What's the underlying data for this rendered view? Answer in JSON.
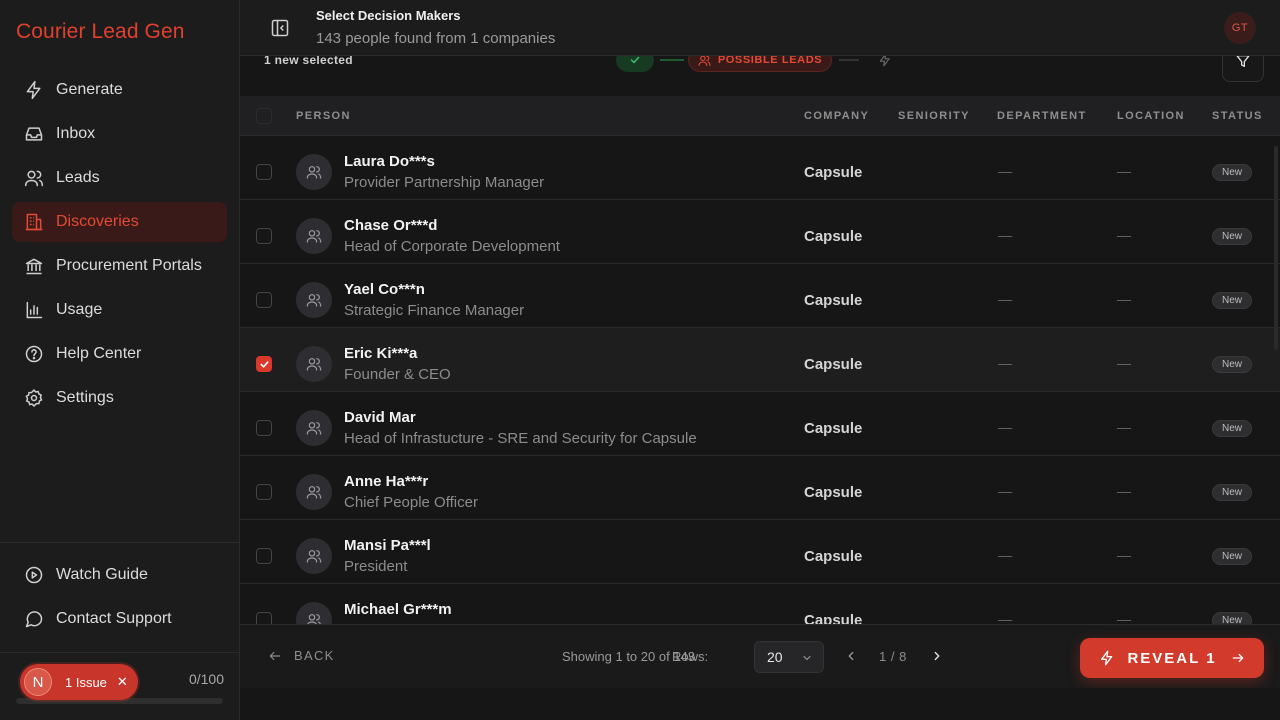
{
  "app": {
    "brand": "Courier Lead Gen"
  },
  "sidebar": {
    "items": [
      {
        "label": "Generate",
        "icon": "bolt-icon",
        "active": false
      },
      {
        "label": "Inbox",
        "icon": "inbox-icon",
        "active": false
      },
      {
        "label": "Leads",
        "icon": "users-icon",
        "active": false
      },
      {
        "label": "Discoveries",
        "icon": "building-icon",
        "active": true
      },
      {
        "label": "Procurement Portals",
        "icon": "landmark-icon",
        "active": false
      },
      {
        "label": "Usage",
        "icon": "bar-chart-icon",
        "active": false
      },
      {
        "label": "Help Center",
        "icon": "help-circle-icon",
        "active": false
      },
      {
        "label": "Settings",
        "icon": "gear-icon",
        "active": false
      }
    ],
    "bottom_items": [
      {
        "label": "Watch Guide",
        "icon": "play-circle-icon"
      },
      {
        "label": "Contact Support",
        "icon": "message-circle-icon"
      }
    ],
    "usage": {
      "count": "0/100",
      "fraction": 0
    },
    "issue": {
      "avatar_letter": "N",
      "label": "1 Issue",
      "close": "✕"
    }
  },
  "header": {
    "title": "Select Decision Makers",
    "subtitle": "143 people found from 1 companies",
    "avatar_initials": "GT"
  },
  "subbar": {
    "selected_note": "1 new selected",
    "step_active_label": "POSSIBLE LEADS"
  },
  "table": {
    "headers": {
      "person": "PERSON",
      "company": "COMPANY",
      "seniority": "SENIORITY",
      "department": "DEPARTMENT",
      "location": "LOCATION",
      "status": "STATUS"
    },
    "rows": [
      {
        "name": "Laura Do***s",
        "title": "Provider Partnership Manager",
        "company": "Capsule",
        "seniority": "—",
        "department": "—",
        "status": "New",
        "checked": false
      },
      {
        "name": "Chase Or***d",
        "title": "Head of Corporate Development",
        "company": "Capsule",
        "seniority": "—",
        "department": "—",
        "status": "New",
        "checked": false
      },
      {
        "name": "Yael Co***n",
        "title": "Strategic Finance Manager",
        "company": "Capsule",
        "seniority": "—",
        "department": "—",
        "status": "New",
        "checked": false
      },
      {
        "name": "Eric Ki***a",
        "title": "Founder & CEO",
        "company": "Capsule",
        "seniority": "—",
        "department": "—",
        "status": "New",
        "checked": true
      },
      {
        "name": "David Mar",
        "title": "Head of Infrastucture - SRE and Security for Capsule",
        "company": "Capsule",
        "seniority": "—",
        "department": "—",
        "status": "New",
        "checked": false
      },
      {
        "name": "Anne Ha***r",
        "title": "Chief People Officer",
        "company": "Capsule",
        "seniority": "—",
        "department": "—",
        "status": "New",
        "checked": false
      },
      {
        "name": "Mansi Pa***l",
        "title": "President",
        "company": "Capsule",
        "seniority": "—",
        "department": "—",
        "status": "New",
        "checked": false
      },
      {
        "name": "Michael Gr***m",
        "title": "",
        "company": "Capsule",
        "seniority": "—",
        "department": "—",
        "status": "New",
        "checked": false
      }
    ]
  },
  "footer": {
    "back_label": "BACK",
    "showing": "Showing 1 to 20 of 143",
    "rows_label": "Rows:",
    "rows_value": "20",
    "page_label": "1 / 8",
    "reveal_label": "REVEAL 1"
  },
  "colors": {
    "accent": "#d23a2b",
    "brand_text": "#e0402e",
    "active_nav_bg": "#3a1a18",
    "success": "#3fbf6a"
  }
}
